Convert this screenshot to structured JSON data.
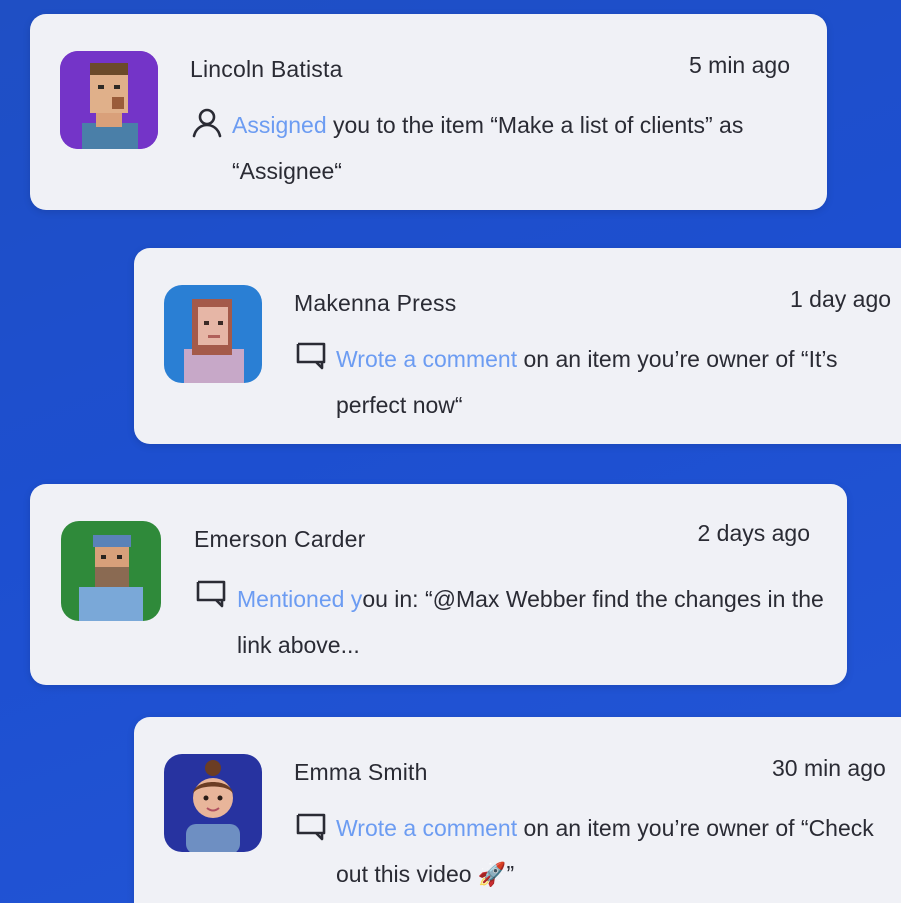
{
  "notifications": [
    {
      "name": "Lincoln Batista",
      "time": "5 min ago",
      "icon": "user-icon",
      "action": "Assigned",
      "text": " you to the item “Make a list of clients” as “Assignee“"
    },
    {
      "name": "Makenna Press",
      "time": "1 day ago",
      "icon": "comment-icon",
      "action": "Wrote a comment",
      "text": " on an item you’re owner of “It’s perfect now“"
    },
    {
      "name": "Emerson Carder",
      "time": "2 days ago",
      "icon": "comment-icon",
      "action": "Mentioned y",
      "text": "ou in: “@Max Webber find the changes in the link above..."
    },
    {
      "name": "Emma Smith",
      "time": "30 min ago",
      "icon": "comment-icon",
      "action": "Wrote a comment",
      "text": " on an item you’re owner of “Check out this video 🚀”"
    }
  ],
  "colors": {
    "accent": "#6c9cf2",
    "card": "#f0f1f6",
    "background": "#1f4fc4"
  }
}
